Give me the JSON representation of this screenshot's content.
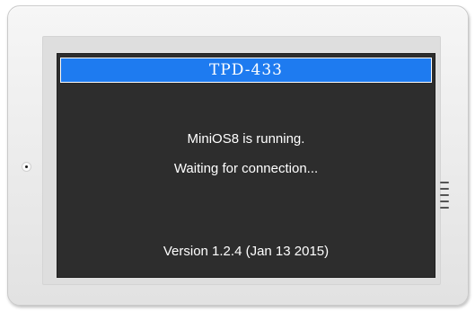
{
  "screen": {
    "title": "TPD-433",
    "message_line1": "MiniOS8 is running.",
    "message_line2": "Waiting for connection...",
    "version": "Version 1.2.4 (Jan 13 2015)"
  },
  "colors": {
    "title_bar": "#1e7bf0",
    "screen_background": "#2d2d2d",
    "text": "#ffffff",
    "bezel": "#ececec"
  },
  "icons": {
    "left": "camera-icon",
    "right": "speaker-grille-icon"
  }
}
